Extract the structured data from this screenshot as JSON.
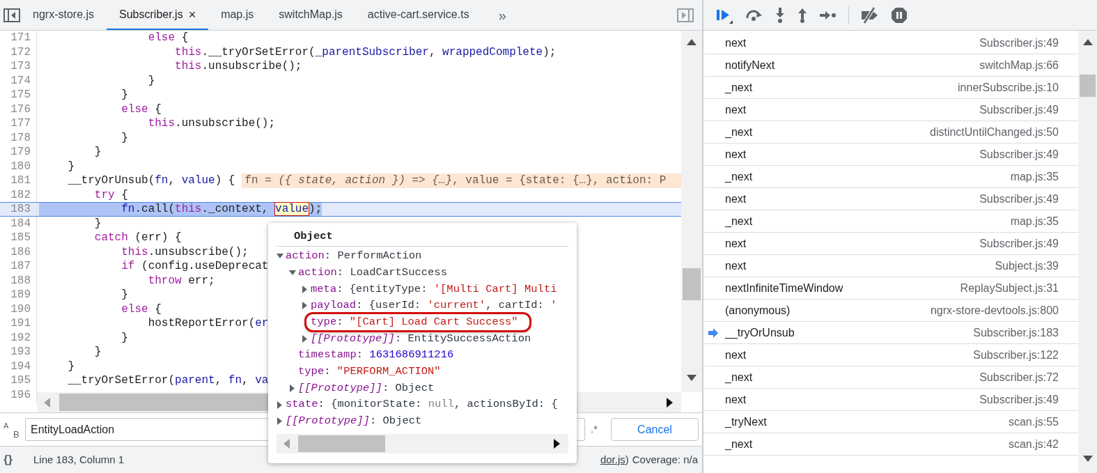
{
  "tabs": [
    {
      "label": "ngrx-store.js",
      "selected": false
    },
    {
      "label": "Subscriber.js",
      "selected": true,
      "close": "×"
    },
    {
      "label": "map.js",
      "selected": false
    },
    {
      "label": "switchMap.js",
      "selected": false
    },
    {
      "label": "active-cart.service.ts",
      "selected": false
    }
  ],
  "more_tabs": "»",
  "code": {
    "lines": [
      {
        "number": "171",
        "current": false,
        "tokens": [
          {
            "text": "                else",
            "kind": "keyword"
          },
          {
            "text": " {",
            "kind": "plain"
          }
        ]
      },
      {
        "number": "172",
        "current": false,
        "tokens": [
          {
            "text": "                    this",
            "kind": "keyword"
          },
          {
            "text": ".__tryOrSetError(",
            "kind": "plain"
          },
          {
            "text": "_parentSubscriber",
            "kind": "variable"
          },
          {
            "text": ", ",
            "kind": "plain"
          },
          {
            "text": "wrappedComplete",
            "kind": "variable"
          },
          {
            "text": ");",
            "kind": "plain"
          }
        ]
      },
      {
        "number": "173",
        "current": false,
        "tokens": [
          {
            "text": "                    this",
            "kind": "keyword"
          },
          {
            "text": ".unsubscribe();",
            "kind": "plain"
          }
        ]
      },
      {
        "number": "174",
        "current": false,
        "tokens": [
          {
            "text": "                }",
            "kind": "plain"
          }
        ]
      },
      {
        "number": "175",
        "current": false,
        "tokens": [
          {
            "text": "            }",
            "kind": "plain"
          }
        ]
      },
      {
        "number": "176",
        "current": false,
        "tokens": [
          {
            "text": "            else",
            "kind": "keyword"
          },
          {
            "text": " {",
            "kind": "plain"
          }
        ]
      },
      {
        "number": "177",
        "current": false,
        "tokens": [
          {
            "text": "                this",
            "kind": "keyword"
          },
          {
            "text": ".unsubscribe();",
            "kind": "plain"
          }
        ]
      },
      {
        "number": "178",
        "current": false,
        "tokens": [
          {
            "text": "            }",
            "kind": "plain"
          }
        ]
      },
      {
        "number": "179",
        "current": false,
        "tokens": [
          {
            "text": "        }",
            "kind": "plain"
          }
        ]
      },
      {
        "number": "180",
        "current": false,
        "tokens": [
          {
            "text": "    }",
            "kind": "plain"
          }
        ]
      },
      {
        "number": "181",
        "current": false,
        "tokens": [
          {
            "text": "    __tryOrUnsub(",
            "kind": "plain"
          },
          {
            "text": "fn",
            "kind": "variable"
          },
          {
            "text": ", ",
            "kind": "plain"
          },
          {
            "text": "value",
            "kind": "variable"
          },
          {
            "text": ") {",
            "kind": "plain"
          }
        ],
        "inline_value": "fn = *({ state, action }) => {…}*, value = {state: {…}, action: P"
      },
      {
        "number": "182",
        "current": false,
        "tokens": [
          {
            "text": "        try",
            "kind": "keyword"
          },
          {
            "text": " {",
            "kind": "plain"
          }
        ]
      },
      {
        "number": "183",
        "current": true,
        "tokens": [
          {
            "text": "            fn",
            "kind": "variable"
          },
          {
            "text": ".call(",
            "kind": "plain"
          },
          {
            "text": "this",
            "kind": "keyword"
          },
          {
            "text": "._context, ",
            "kind": "plain"
          },
          {
            "text": "value",
            "kind": "hover"
          },
          {
            "text": ");",
            "kind": "plain"
          }
        ]
      },
      {
        "number": "184",
        "current": false,
        "tokens": [
          {
            "text": "        }",
            "kind": "plain"
          }
        ]
      },
      {
        "number": "185",
        "current": false,
        "tokens": [
          {
            "text": "        catch",
            "kind": "keyword"
          },
          {
            "text": " (err) {",
            "kind": "plain"
          }
        ]
      },
      {
        "number": "186",
        "current": false,
        "tokens": [
          {
            "text": "            this",
            "kind": "keyword"
          },
          {
            "text": ".unsubscribe();",
            "kind": "plain"
          }
        ]
      },
      {
        "number": "187",
        "current": false,
        "tokens": [
          {
            "text": "            if",
            "kind": "keyword"
          },
          {
            "text": " (config.useDeprecat",
            "kind": "plain"
          }
        ]
      },
      {
        "number": "188",
        "current": false,
        "tokens": [
          {
            "text": "                throw",
            "kind": "keyword"
          },
          {
            "text": " err;",
            "kind": "plain"
          }
        ]
      },
      {
        "number": "189",
        "current": false,
        "tokens": [
          {
            "text": "            }",
            "kind": "plain"
          }
        ]
      },
      {
        "number": "190",
        "current": false,
        "tokens": [
          {
            "text": "            else",
            "kind": "keyword"
          },
          {
            "text": " {",
            "kind": "plain"
          }
        ]
      },
      {
        "number": "191",
        "current": false,
        "tokens": [
          {
            "text": "                hostReportError(",
            "kind": "plain"
          },
          {
            "text": "er",
            "kind": "variable"
          }
        ]
      },
      {
        "number": "192",
        "current": false,
        "tokens": [
          {
            "text": "            }",
            "kind": "plain"
          }
        ]
      },
      {
        "number": "193",
        "current": false,
        "tokens": [
          {
            "text": "        }",
            "kind": "plain"
          }
        ]
      },
      {
        "number": "194",
        "current": false,
        "tokens": [
          {
            "text": "    }",
            "kind": "plain"
          }
        ]
      },
      {
        "number": "195",
        "current": false,
        "tokens": [
          {
            "text": "    __tryOrSetError(",
            "kind": "plain"
          },
          {
            "text": "parent",
            "kind": "variable"
          },
          {
            "text": ", ",
            "kind": "plain"
          },
          {
            "text": "fn",
            "kind": "variable"
          },
          {
            "text": ", ",
            "kind": "plain"
          },
          {
            "text": "va",
            "kind": "variable"
          }
        ]
      },
      {
        "number": "196",
        "current": false
      }
    ]
  },
  "popover": {
    "title": "Object",
    "tree": [
      {
        "key": "action",
        "kind": "property",
        "expanded": true,
        "highlighted": false,
        "value": [
          {
            "text": ": PerformAction",
            "kind": "plain"
          }
        ],
        "children": [
          {
            "key": "action",
            "kind": "property",
            "expanded": true,
            "highlighted": false,
            "value": [
              {
                "text": ": LoadCartSuccess",
                "kind": "plain"
              }
            ],
            "children": [
              {
                "key": "meta",
                "kind": "property",
                "expanded": false,
                "highlighted": false,
                "value": [
                  {
                    "text": ": {entityType: ",
                    "kind": "plain"
                  },
                  {
                    "text": "'[Multi Cart] Multi",
                    "kind": "string"
                  }
                ]
              },
              {
                "key": "payload",
                "kind": "property",
                "expanded": false,
                "highlighted": false,
                "value": [
                  {
                    "text": ": {userId: ",
                    "kind": "plain"
                  },
                  {
                    "text": "'current'",
                    "kind": "string"
                  },
                  {
                    "text": ", cartId: ",
                    "kind": "plain"
                  },
                  {
                    "text": "'",
                    "kind": "string"
                  }
                ]
              },
              {
                "key": "type",
                "kind": "property",
                "highlighted": true,
                "value": [
                  {
                    "text": ": ",
                    "kind": "plain"
                  },
                  {
                    "text": "\"[Cart] Load Cart Success\"",
                    "kind": "string"
                  }
                ]
              },
              {
                "key": "[[Prototype]]",
                "kind": "internal",
                "expanded": false,
                "highlighted": false,
                "value": [
                  {
                    "text": ": EntitySuccessAction",
                    "kind": "plain"
                  }
                ]
              }
            ]
          },
          {
            "key": "timestamp",
            "kind": "property",
            "highlighted": false,
            "value": [
              {
                "text": ": ",
                "kind": "plain"
              },
              {
                "text": "1631686911216",
                "kind": "number"
              }
            ]
          },
          {
            "key": "type",
            "kind": "property",
            "highlighted": false,
            "value": [
              {
                "text": ": ",
                "kind": "plain"
              },
              {
                "text": "\"PERFORM_ACTION\"",
                "kind": "string"
              }
            ]
          },
          {
            "key": "[[Prototype]]",
            "kind": "internal",
            "expanded": false,
            "highlighted": false,
            "value": [
              {
                "text": ": Object",
                "kind": "plain"
              }
            ]
          }
        ]
      },
      {
        "key": "state",
        "kind": "property",
        "expanded": false,
        "highlighted": false,
        "value": [
          {
            "text": ": {monitorState: ",
            "kind": "plain"
          },
          {
            "text": "null",
            "kind": "null"
          },
          {
            "text": ", actionsById: {",
            "kind": "plain"
          }
        ]
      },
      {
        "key": "[[Prototype]]",
        "kind": "internal",
        "expanded": false,
        "highlighted": false,
        "value": [
          {
            "text": ": Object",
            "kind": "plain"
          }
        ]
      }
    ]
  },
  "search": {
    "case_label_upper": "A",
    "case_label_lower": "B",
    "value": "EntityLoadAction",
    "regex": ".*",
    "cancel": "Cancel"
  },
  "status_bar": {
    "format_button": "{}",
    "position": "Line 183, Column 1",
    "source_link": "dor.js",
    "source_suffix": ")",
    "coverage": "Coverage: n/a"
  },
  "call_stack": [
    {
      "function": "next",
      "location": "Subscriber.js:49",
      "selected": false
    },
    {
      "function": "notifyNext",
      "location": "switchMap.js:66",
      "selected": false
    },
    {
      "function": "_next",
      "location": "innerSubscribe.js:10",
      "selected": false
    },
    {
      "function": "next",
      "location": "Subscriber.js:49",
      "selected": false
    },
    {
      "function": "_next",
      "location": "distinctUntilChanged.js:50",
      "selected": false
    },
    {
      "function": "next",
      "location": "Subscriber.js:49",
      "selected": false
    },
    {
      "function": "_next",
      "location": "map.js:35",
      "selected": false
    },
    {
      "function": "next",
      "location": "Subscriber.js:49",
      "selected": false
    },
    {
      "function": "_next",
      "location": "map.js:35",
      "selected": false
    },
    {
      "function": "next",
      "location": "Subscriber.js:49",
      "selected": false
    },
    {
      "function": "next",
      "location": "Subject.js:39",
      "selected": false
    },
    {
      "function": "nextInfiniteTimeWindow",
      "location": "ReplaySubject.js:31",
      "selected": false
    },
    {
      "function": "(anonymous)",
      "location": "ngrx-store-devtools.js:800",
      "selected": false
    },
    {
      "function": "__tryOrUnsub",
      "location": "Subscriber.js:183",
      "selected": true
    },
    {
      "function": "next",
      "location": "Subscriber.js:122",
      "selected": false
    },
    {
      "function": "_next",
      "location": "Subscriber.js:72",
      "selected": false
    },
    {
      "function": "next",
      "location": "Subscriber.js:49",
      "selected": false
    },
    {
      "function": "_tryNext",
      "location": "scan.js:55",
      "selected": false
    },
    {
      "function": "_next",
      "location": "scan.js:42",
      "selected": false
    }
  ]
}
